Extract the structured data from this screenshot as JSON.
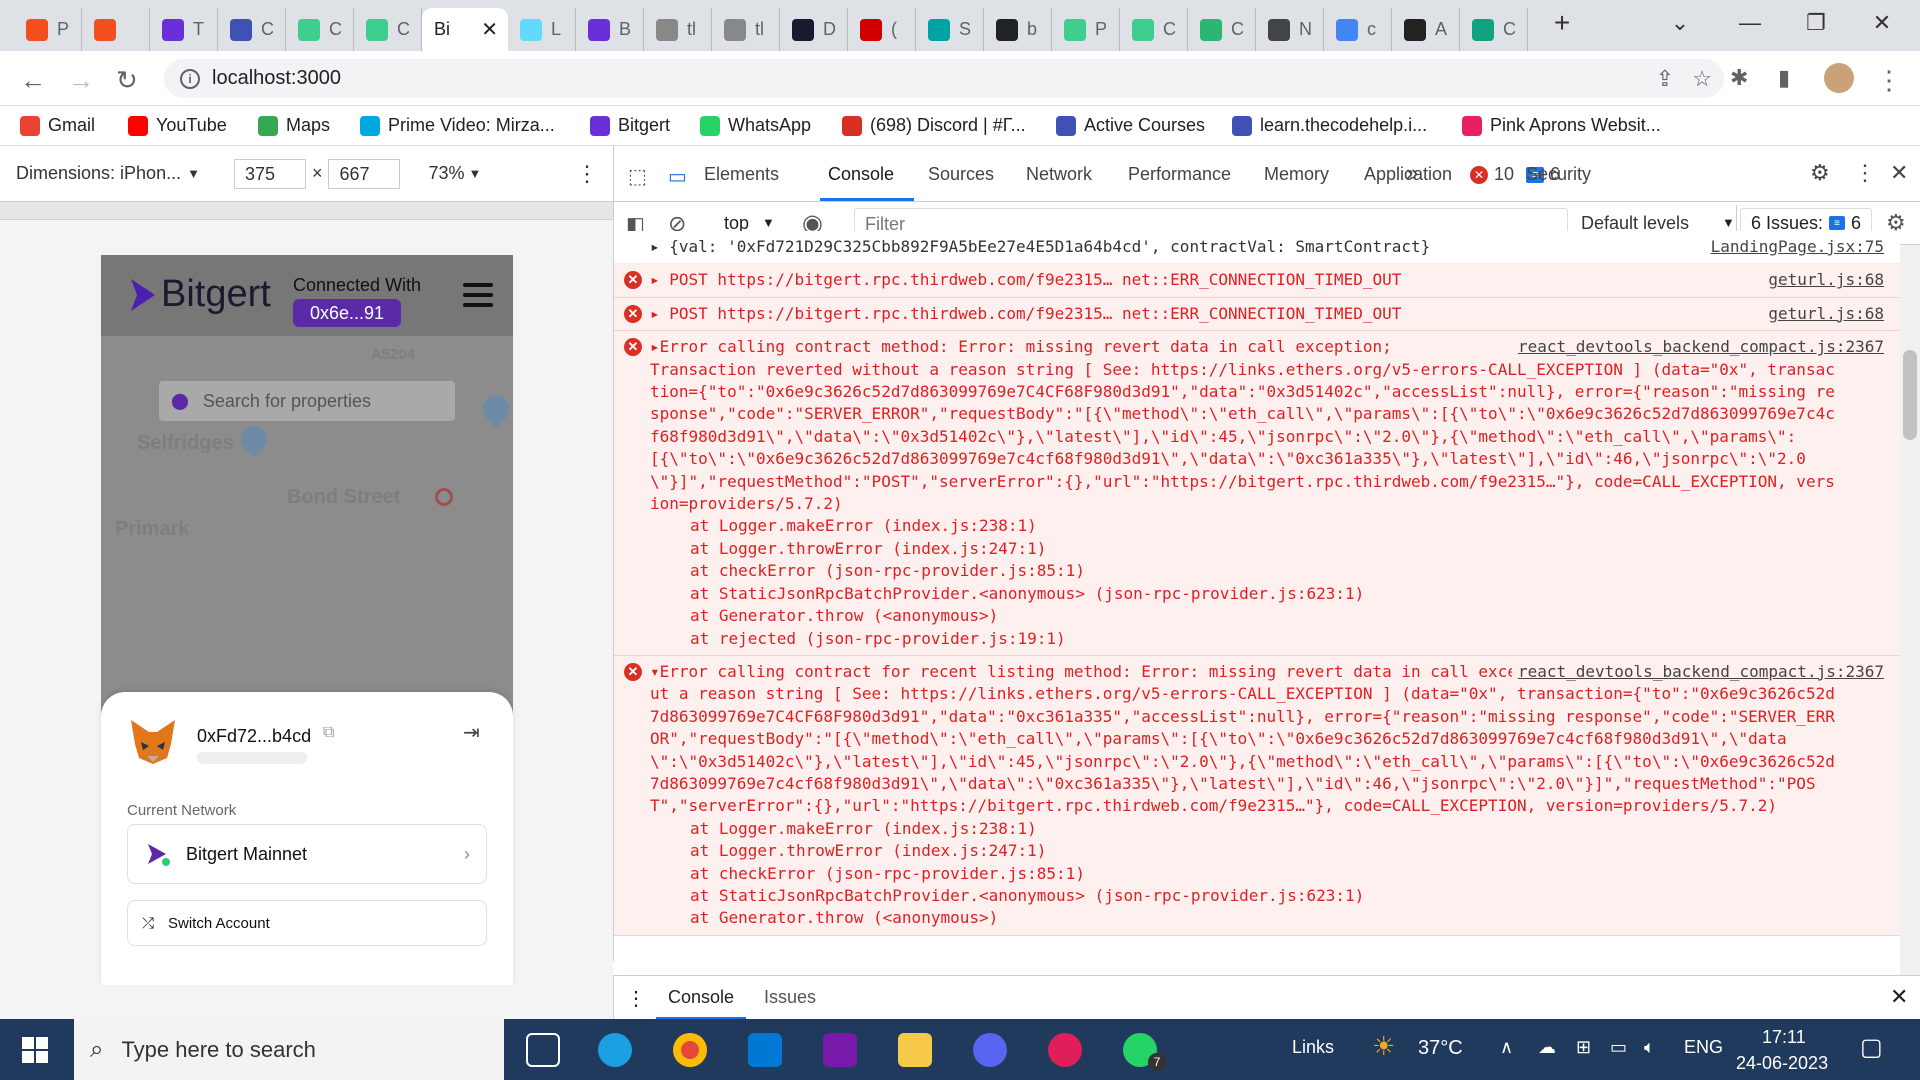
{
  "browser": {
    "tabs": [
      {
        "label": "P",
        "color": "#f24e1e"
      },
      {
        "label": "",
        "color": "#f24e1e"
      },
      {
        "label": "T",
        "color": "#6b2fd9"
      },
      {
        "label": "C",
        "color": "#3f51b5"
      },
      {
        "label": "C",
        "color": "#3ecf8e"
      },
      {
        "label": "C",
        "color": "#3ecf8e"
      },
      {
        "label": "Bi",
        "color": "#ffffff",
        "active": true
      },
      {
        "label": "L",
        "color": "#61dafb"
      },
      {
        "label": "B",
        "color": "#6b2fd9"
      },
      {
        "label": "tl",
        "color": "#888888"
      },
      {
        "label": "tl",
        "color": "#888888"
      },
      {
        "label": "D",
        "color": "#1a1a2e"
      },
      {
        "label": "(",
        "color": "#d00000"
      },
      {
        "label": "S",
        "color": "#00a3a3"
      },
      {
        "label": "b",
        "color": "#222222"
      },
      {
        "label": "P",
        "color": "#3ecf8e"
      },
      {
        "label": "C",
        "color": "#3ecf8e"
      },
      {
        "label": "C",
        "color": "#2bb673"
      },
      {
        "label": "N",
        "color": "#444444"
      },
      {
        "label": "c",
        "color": "#4285f4"
      },
      {
        "label": "A",
        "color": "#222222"
      },
      {
        "label": "C",
        "color": "#10a37f"
      }
    ],
    "url": "localhost:3000",
    "bookmarks": [
      {
        "label": "Gmail",
        "color": "#ea4335"
      },
      {
        "label": "YouTube",
        "color": "#ff0000"
      },
      {
        "label": "Maps",
        "color": "#34a853"
      },
      {
        "label": "Prime Video: Mirza...",
        "color": "#00a8e1"
      },
      {
        "label": "Bitgert",
        "color": "#6b2fd9"
      },
      {
        "label": "WhatsApp",
        "color": "#25d366"
      },
      {
        "label": "(698) Discord | #Γ...",
        "color": "#d93025"
      },
      {
        "label": "Active Courses",
        "color": "#3f51b5"
      },
      {
        "label": "learn.thecodehelp.i...",
        "color": "#3f51b5"
      },
      {
        "label": "Pink Aprons Websit...",
        "color": "#e91e63"
      }
    ]
  },
  "device_toolbar": {
    "dimensions_label": "Dimensions: iPhon...",
    "width": "375",
    "times": "×",
    "height": "667",
    "zoom": "73%"
  },
  "app": {
    "logo_text": "Bitgert",
    "connected_label": "Connected With",
    "connected_address": "0x6e...91",
    "search_placeholder": "Search for properties",
    "map_labels": [
      "Selfridges",
      "Bond Street",
      "Primark",
      "A5204"
    ],
    "wallet": {
      "address": "0xFd72...b4cd",
      "current_network_label": "Current Network",
      "network_name": "Bitgert Mainnet",
      "switch_account_label": "Switch Account"
    }
  },
  "devtools": {
    "tabs": [
      "Elements",
      "Console",
      "Sources",
      "Network",
      "Performance",
      "Memory",
      "Application",
      "Security"
    ],
    "active_tab": "Console",
    "more_tabs": "»",
    "error_count": "10",
    "message_count": "6",
    "context": "top",
    "filter_placeholder": "Filter",
    "levels": "Default levels",
    "issues_label": "6 Issues:",
    "issues_count": "6",
    "messages": [
      {
        "kind": "plain",
        "text": "▸ {val: '0xFd721D29C325Cbb892F9A5bEe27e4E5D1a64b4cd', contractVal: SmartContract}",
        "source": "LandingPage.jsx:75"
      },
      {
        "kind": "error",
        "text": "▸ POST https://bitgert.rpc.thirdweb.com/f9e2315… net::ERR_CONNECTION_TIMED_OUT",
        "source": "geturl.js:68"
      },
      {
        "kind": "error",
        "text": "▸ POST https://bitgert.rpc.thirdweb.com/f9e2315… net::ERR_CONNECTION_TIMED_OUT",
        "source": "geturl.js:68"
      },
      {
        "kind": "error",
        "text": "▸Error calling contract method: Error: missing revert data in call exception;\nTransaction reverted without a reason string [ See: https://links.ethers.org/v5-errors-CALL_EXCEPTION ] (data=\"0x\", transaction={\"to\":\"0x6e9c3626c52d7d863099769e7C4CF68F980d3d91\",\"data\":\"0x3d51402c\",\"accessList\":null}, error={\"reason\":\"missing response\",\"code\":\"SERVER_ERROR\",\"requestBody\":\"[{\\\"method\\\":\\\"eth_call\\\",\\\"params\\\":[{\\\"to\\\":\\\"0x6e9c3626c52d7d863099769e7c4cf68f980d3d91\\\",\\\"data\\\":\\\"0x3d51402c\\\"},\\\"latest\\\"],\\\"id\\\":45,\\\"jsonrpc\\\":\\\"2.0\\\"},{\\\"method\\\":\\\"eth_call\\\",\\\"params\\\":[{\\\"to\\\":\\\"0x6e9c3626c52d7d863099769e7c4cf68f980d3d91\\\",\\\"data\\\":\\\"0xc361a335\\\"},\\\"latest\\\"],\\\"id\\\":46,\\\"jsonrpc\\\":\\\"2.0\\\"}]\",\"requestMethod\":\"POST\",\"serverError\":{},\"url\":\"https://bitgert.rpc.thirdweb.com/f9e2315…\"}, code=CALL_EXCEPTION, version=providers/5.7.2)",
        "source": "react_devtools_backend_compact.js:2367",
        "stack": [
          "at Logger.makeError (index.js:238:1)",
          "at Logger.throwError (index.js:247:1)",
          "at checkError (json-rpc-provider.js:85:1)",
          "at StaticJsonRpcBatchProvider.<anonymous> (json-rpc-provider.js:623:1)",
          "at Generator.throw (<anonymous>)",
          "at rejected (json-rpc-provider.js:19:1)"
        ]
      },
      {
        "kind": "error",
        "text": "▾Error calling contract for recent listing method: Error: missing revert data in call exception; Transaction reverted without a reason string [ See: https://links.ethers.org/v5-errors-CALL_EXCEPTION ] (data=\"0x\", transaction={\"to\":\"0x6e9c3626c52d7d863099769e7C4CF68F980d3d91\",\"data\":\"0xc361a335\",\"accessList\":null}, error={\"reason\":\"missing response\",\"code\":\"SERVER_ERROR\",\"requestBody\":\"[{\\\"method\\\":\\\"eth_call\\\",\\\"params\\\":[{\\\"to\\\":\\\"0x6e9c3626c52d7d863099769e7c4cf68f980d3d91\\\",\\\"data\\\":\\\"0x3d51402c\\\"},\\\"latest\\\"],\\\"id\\\":45,\\\"jsonrpc\\\":\\\"2.0\\\"},{\\\"method\\\":\\\"eth_call\\\",\\\"params\\\":[{\\\"to\\\":\\\"0x6e9c3626c52d7d863099769e7c4cf68f980d3d91\\\",\\\"data\\\":\\\"0xc361a335\\\"},\\\"latest\\\"],\\\"id\\\":46,\\\"jsonrpc\\\":\\\"2.0\\\"}]\",\"requestMethod\":\"POST\",\"serverError\":{},\"url\":\"https://bitgert.rpc.thirdweb.com/f9e2315…\"}, code=CALL_EXCEPTION, version=providers/5.7.2)",
        "source": "react_devtools_backend_compact.js:2367",
        "stack": [
          "at Logger.makeError (index.js:238:1)",
          "at Logger.throwError (index.js:247:1)",
          "at checkError (json-rpc-provider.js:85:1)",
          "at StaticJsonRpcBatchProvider.<anonymous> (json-rpc-provider.js:623:1)",
          "at Generator.throw (<anonymous>)"
        ]
      }
    ],
    "drawer_tabs": [
      "Console",
      "Issues"
    ]
  },
  "taskbar": {
    "search_placeholder": "Type here to search",
    "links_label": "Links",
    "temperature": "37°C",
    "language": "ENG",
    "time": "17:11",
    "date": "24-06-2023",
    "whatsapp_badge": "7"
  }
}
